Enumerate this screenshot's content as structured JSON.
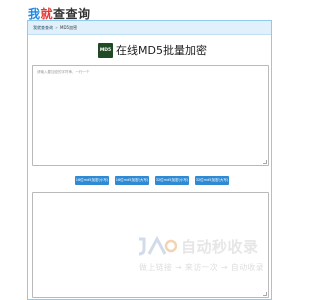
{
  "logo": {
    "part1": "我",
    "part2": "就",
    "part3": "查查询"
  },
  "breadcrumb": {
    "home": "我就查查询",
    "separator": "»",
    "current": "MD5加密"
  },
  "tool": {
    "badge": "MD5",
    "title": "在线MD5批量加密"
  },
  "input": {
    "placeholder": "请输入要加密的字符串，一行一个"
  },
  "buttons": [
    {
      "label": "16位md5加密(小写)"
    },
    {
      "label": "16位md5加密(大写)"
    },
    {
      "label": "32位md5加密(小写)"
    },
    {
      "label": "32位md5加密(大写)"
    }
  ],
  "watermark": {
    "main": "自动秒收录",
    "sub": "做上链接 → 来访一次 → 自动收录"
  },
  "colors": {
    "button": "#2f8ad3",
    "crumb_bar": "#e1f1fb",
    "frame_border": "#8fc9ec",
    "badge": "#1f4a24"
  }
}
